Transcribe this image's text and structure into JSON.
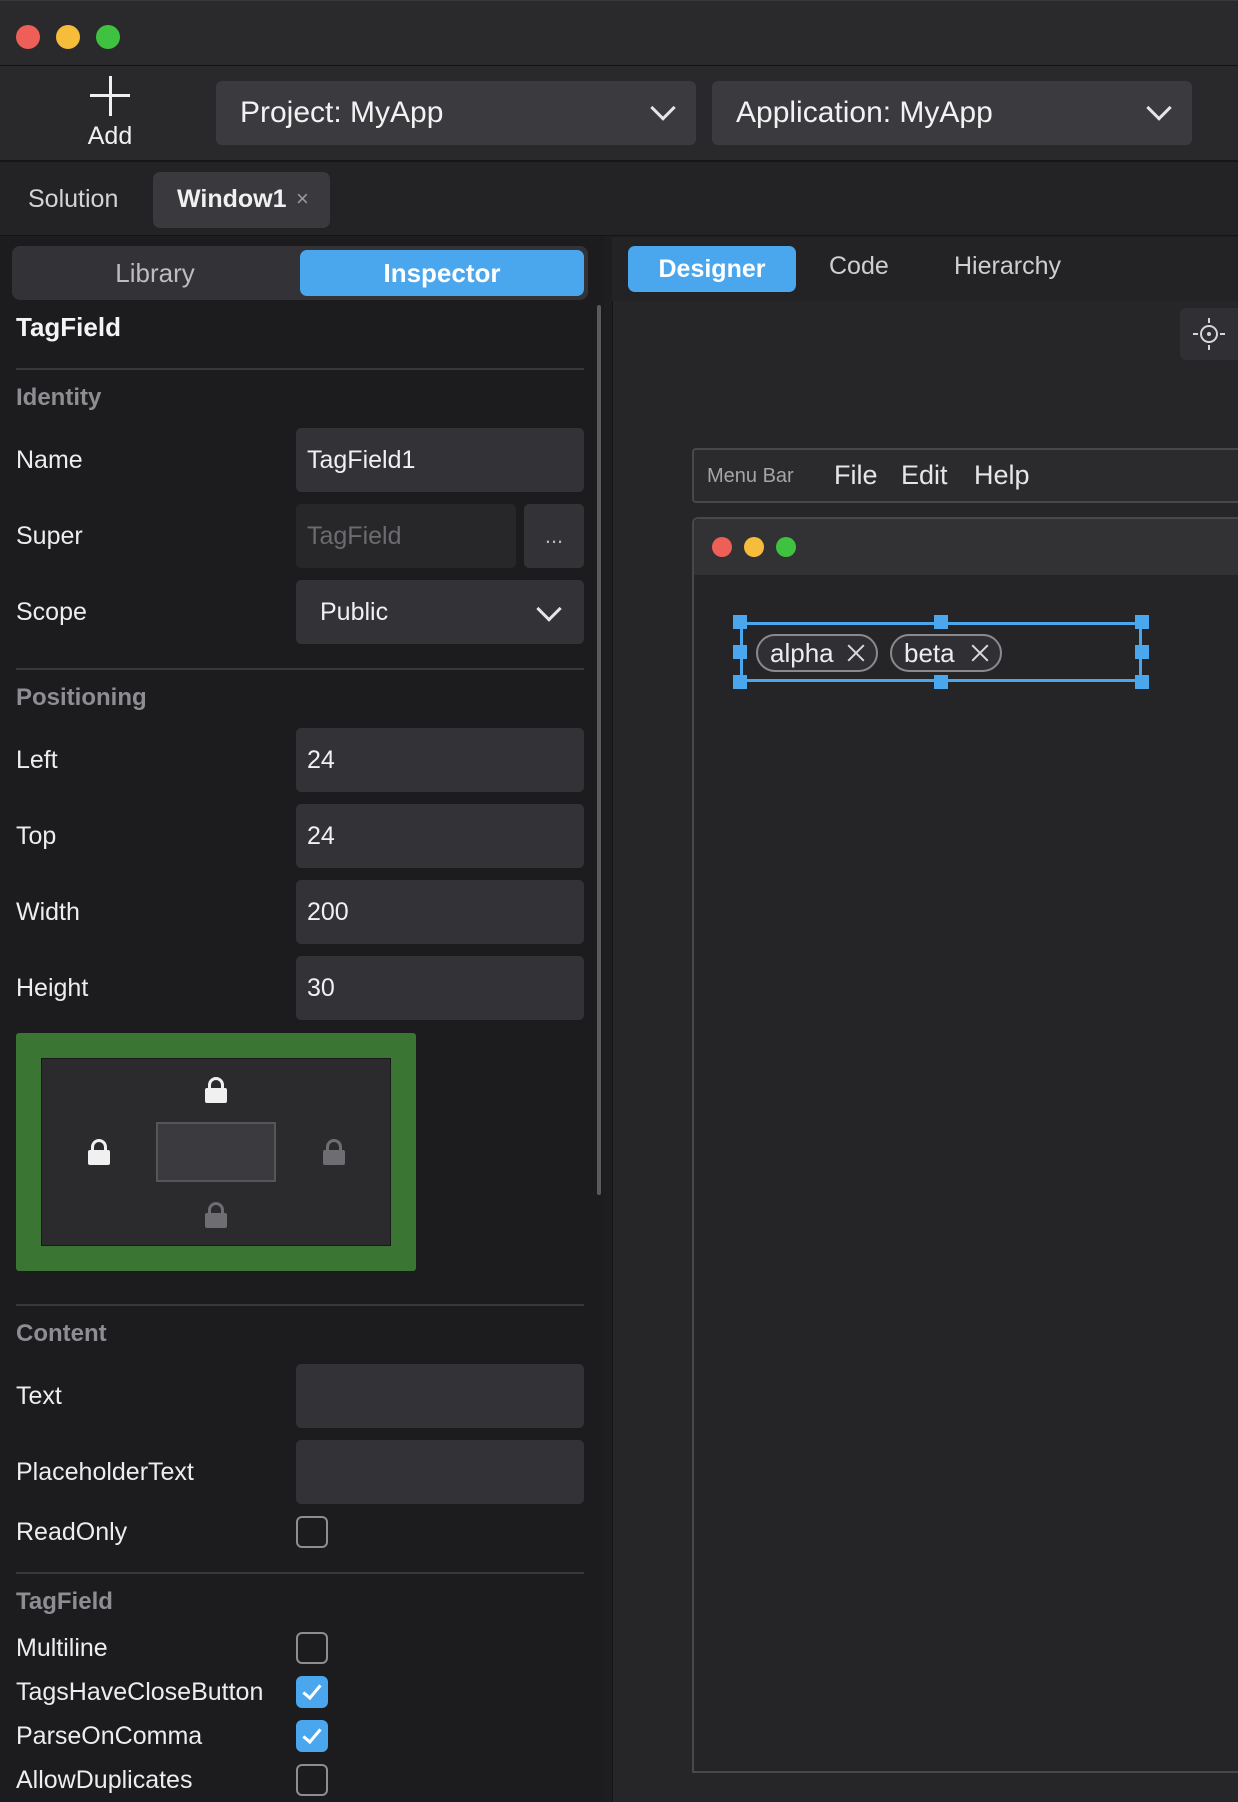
{
  "toolbar": {
    "add_label": "Add",
    "project_dropdown": "Project: MyApp",
    "application_dropdown": "Application: MyApp"
  },
  "tabs": {
    "solution": "Solution",
    "window1": "Window1",
    "close": "×"
  },
  "inspector": {
    "segment_library": "Library",
    "segment_inspector": "Inspector",
    "control_title": "TagField",
    "identity": {
      "section": "Identity",
      "name_label": "Name",
      "name_value": "TagField1",
      "super_label": "Super",
      "super_value": "TagField",
      "super_more": "...",
      "scope_label": "Scope",
      "scope_value": "Public"
    },
    "positioning": {
      "section": "Positioning",
      "left_label": "Left",
      "left_value": "24",
      "top_label": "Top",
      "top_value": "24",
      "width_label": "Width",
      "width_value": "200",
      "height_label": "Height",
      "height_value": "30"
    },
    "locks": {
      "top_locked": true,
      "left_locked": true,
      "right_locked": false,
      "bottom_locked": false
    },
    "content": {
      "section": "Content",
      "text_label": "Text",
      "text_value": "",
      "placeholder_label": "PlaceholderText",
      "placeholder_value": "",
      "readonly_label": "ReadOnly",
      "readonly_checked": false
    },
    "tagfield": {
      "section": "TagField",
      "multiline_label": "Multiline",
      "multiline_checked": false,
      "close_button_label": "TagsHaveCloseButton",
      "close_button_checked": true,
      "parse_comma_label": "ParseOnComma",
      "parse_comma_checked": true,
      "duplicates_label": "AllowDuplicates",
      "duplicates_checked": false
    }
  },
  "designer": {
    "tab_designer": "Designer",
    "tab_code": "Code",
    "tab_hierarchy": "Hierarchy",
    "menubar_label": "Menu Bar",
    "menu_file": "File",
    "menu_edit": "Edit",
    "menu_help": "Help",
    "tags": [
      "alpha",
      "beta"
    ]
  },
  "colors": {
    "accent": "#4aa7ee",
    "lock_area": "#3a7534",
    "traffic_red": "#ee5f57",
    "traffic_yellow": "#f6bd3b",
    "traffic_green": "#3fc23f"
  },
  "icons": [
    "plus-icon",
    "chevron-down-icon",
    "close-icon",
    "lock-icon",
    "gear-icon",
    "checkmark-icon"
  ]
}
